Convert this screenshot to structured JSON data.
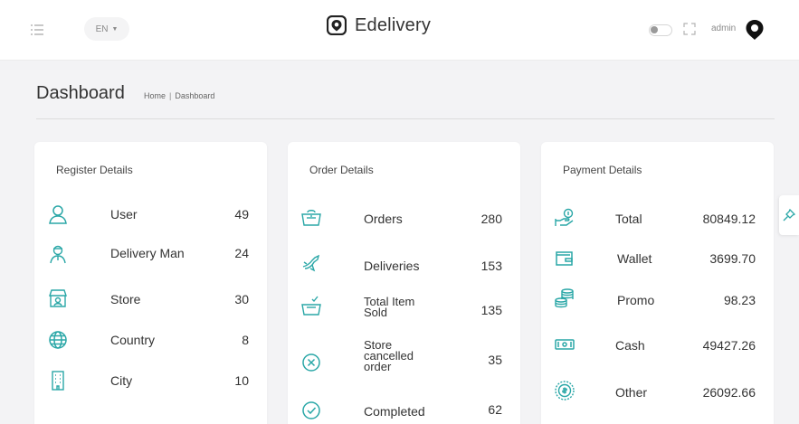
{
  "header": {
    "language": "EN",
    "brand_name": "Edelivery",
    "user_name": "admin"
  },
  "page": {
    "title": "Dashboard",
    "breadcrumb_home": "Home",
    "breadcrumb_separator": "|",
    "breadcrumb_current": "Dashboard"
  },
  "register": {
    "title": "Register Details",
    "items": [
      {
        "label": "User",
        "value": "49",
        "icon": "user-icon"
      },
      {
        "label": "Delivery Man",
        "value": "24",
        "icon": "delivery-man-icon"
      },
      {
        "label": "Store",
        "value": "30",
        "icon": "store-icon"
      },
      {
        "label": "Country",
        "value": "8",
        "icon": "globe-icon"
      },
      {
        "label": "City",
        "value": "10",
        "icon": "building-icon"
      }
    ]
  },
  "orders": {
    "title": "Order Details",
    "items": [
      {
        "label": "Orders",
        "value": "280",
        "icon": "basket-icon"
      },
      {
        "label": "Deliveries",
        "value": "153",
        "icon": "delivery-bird-icon"
      },
      {
        "label_lines": [
          "Total Item",
          "Sold"
        ],
        "value": "135",
        "icon": "basket-check-icon"
      },
      {
        "label_lines": [
          "Store",
          "cancelled",
          "order"
        ],
        "value": "35",
        "icon": "cancel-circle-icon"
      },
      {
        "label": "Completed",
        "value": "62",
        "icon": "check-circle-icon"
      }
    ]
  },
  "payment": {
    "title": "Payment Details",
    "items": [
      {
        "label": "Total",
        "value": "80849.12",
        "icon": "money-hand-icon"
      },
      {
        "label": "Wallet",
        "value": "3699.70",
        "icon": "wallet-icon"
      },
      {
        "label": "Promo",
        "value": "98.23",
        "icon": "coins-stack-icon"
      },
      {
        "label": "Cash",
        "value": "49427.26",
        "icon": "banknote-icon"
      },
      {
        "label": "Other",
        "value": "26092.66",
        "icon": "coin-icon"
      }
    ]
  },
  "colors": {
    "accent": "#2aa7a7",
    "text": "#333333",
    "muted": "#8a8a8a",
    "background": "#f3f3f5",
    "card": "#ffffff"
  }
}
